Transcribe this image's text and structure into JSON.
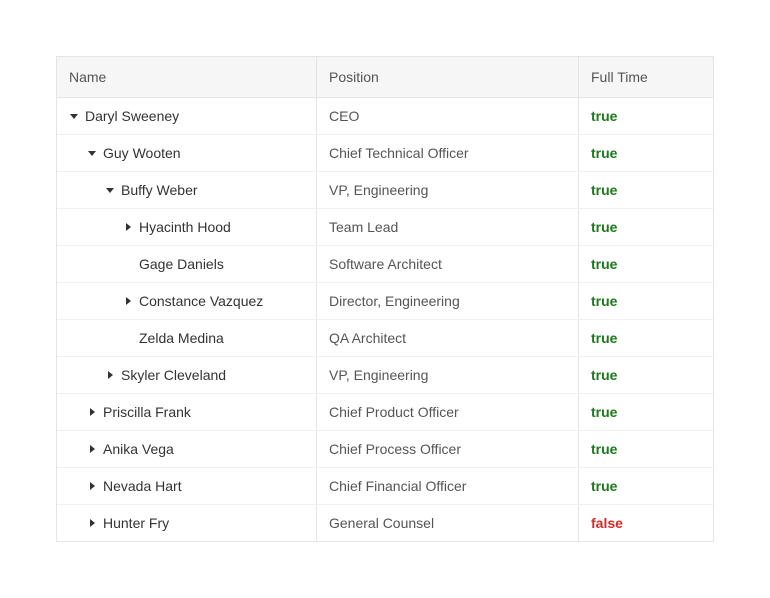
{
  "columns": {
    "name": "Name",
    "position": "Position",
    "fulltime": "Full Time"
  },
  "rows": [
    {
      "name": "Daryl Sweeney",
      "position": "CEO",
      "fullTime": "true",
      "level": 0,
      "toggle": "expanded"
    },
    {
      "name": "Guy Wooten",
      "position": "Chief Technical Officer",
      "fullTime": "true",
      "level": 1,
      "toggle": "expanded"
    },
    {
      "name": "Buffy Weber",
      "position": "VP, Engineering",
      "fullTime": "true",
      "level": 2,
      "toggle": "expanded"
    },
    {
      "name": "Hyacinth Hood",
      "position": "Team Lead",
      "fullTime": "true",
      "level": 3,
      "toggle": "collapsed"
    },
    {
      "name": "Gage Daniels",
      "position": "Software Architect",
      "fullTime": "true",
      "level": 3,
      "toggle": "none"
    },
    {
      "name": "Constance Vazquez",
      "position": "Director, Engineering",
      "fullTime": "true",
      "level": 3,
      "toggle": "collapsed"
    },
    {
      "name": "Zelda Medina",
      "position": "QA Architect",
      "fullTime": "true",
      "level": 3,
      "toggle": "none"
    },
    {
      "name": "Skyler Cleveland",
      "position": "VP, Engineering",
      "fullTime": "true",
      "level": 2,
      "toggle": "collapsed"
    },
    {
      "name": "Priscilla Frank",
      "position": "Chief Product Officer",
      "fullTime": "true",
      "level": 1,
      "toggle": "collapsed"
    },
    {
      "name": "Anika Vega",
      "position": "Chief Process Officer",
      "fullTime": "true",
      "level": 1,
      "toggle": "collapsed"
    },
    {
      "name": "Nevada Hart",
      "position": "Chief Financial Officer",
      "fullTime": "true",
      "level": 1,
      "toggle": "collapsed"
    },
    {
      "name": "Hunter Fry",
      "position": "General Counsel",
      "fullTime": "false",
      "level": 1,
      "toggle": "collapsed"
    }
  ]
}
